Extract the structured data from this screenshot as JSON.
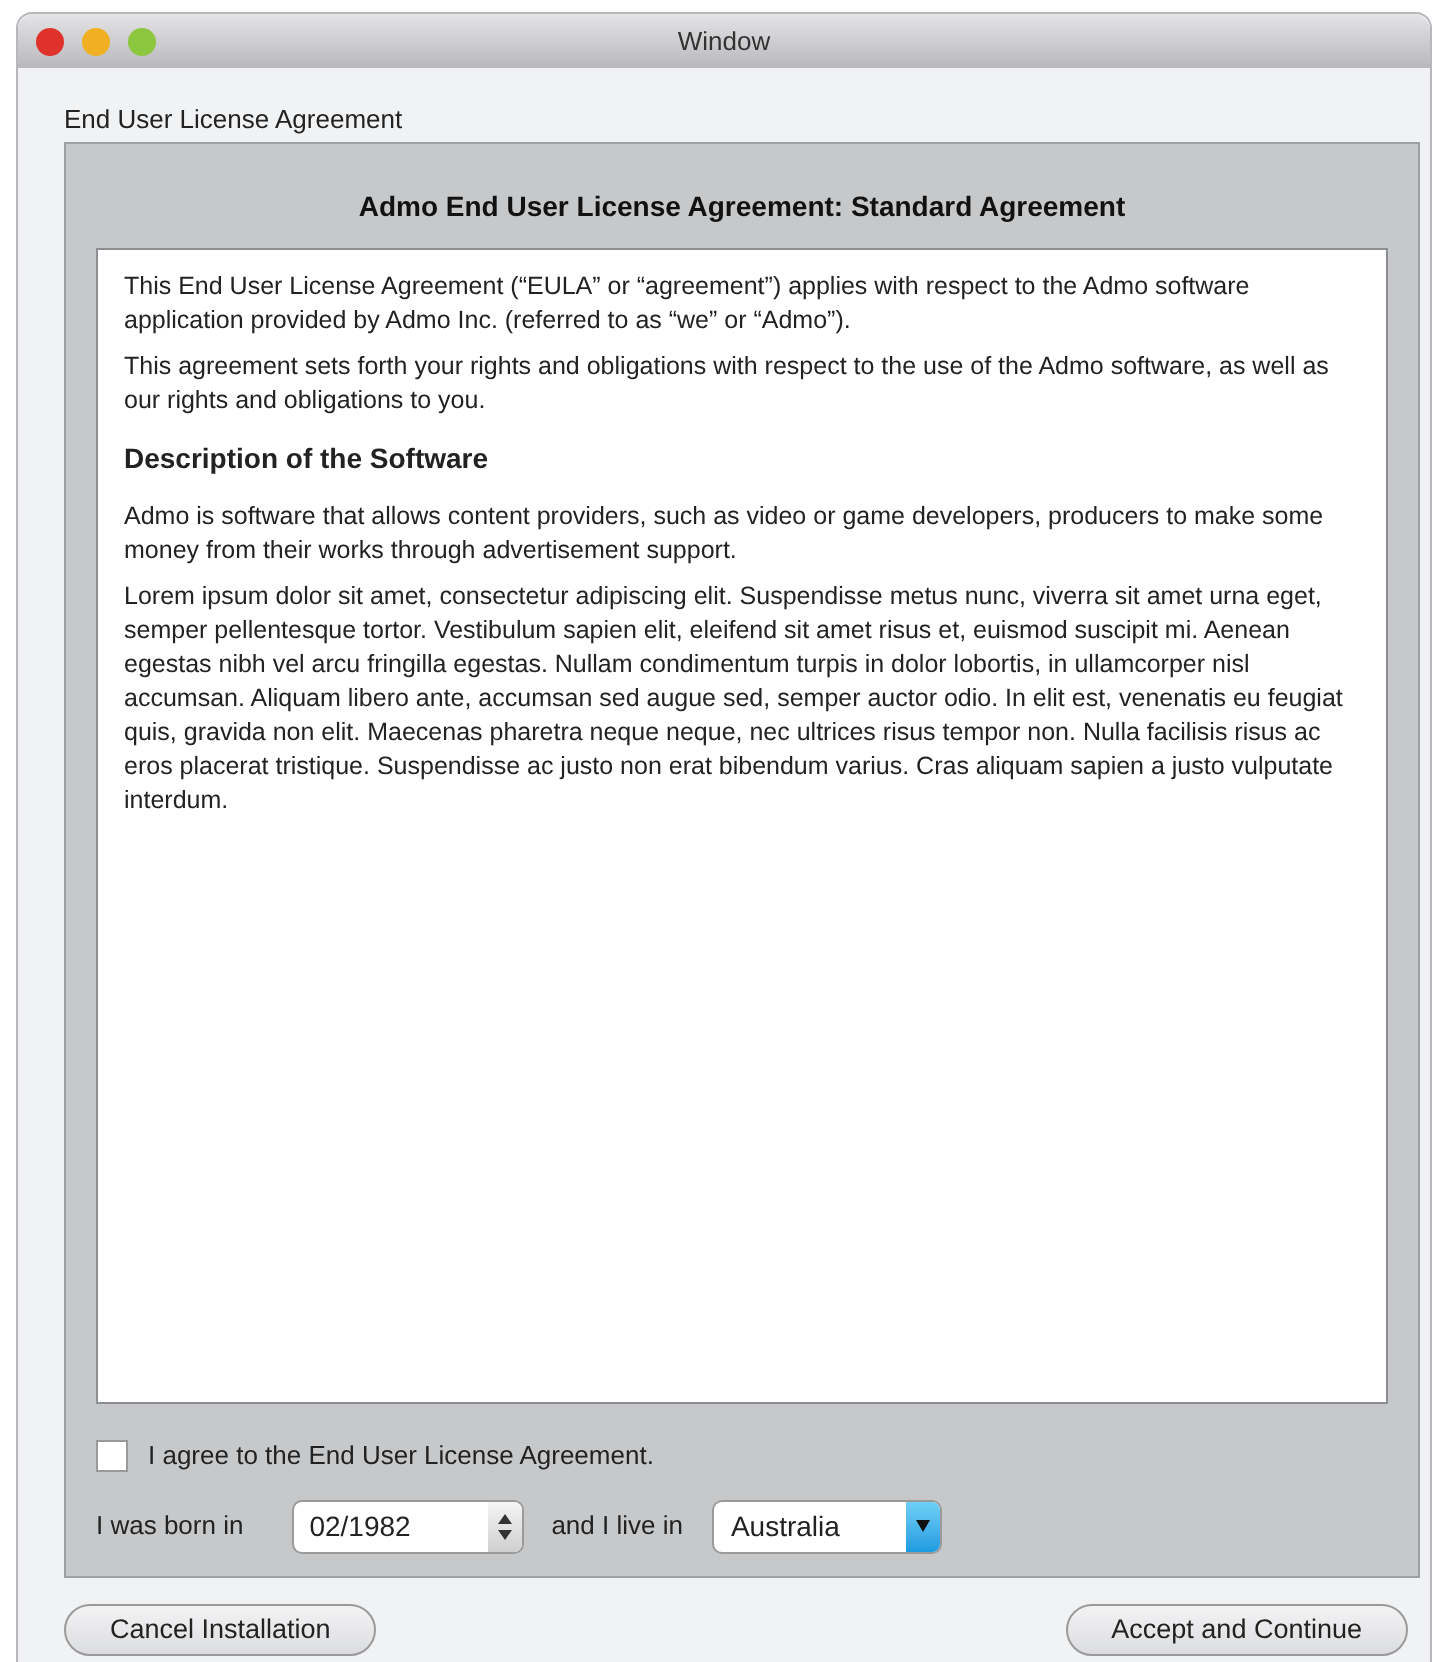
{
  "window": {
    "title": "Window"
  },
  "group_label": "End User License Agreement",
  "agreement": {
    "title": "Admo End User License Agreement: Standard Agreement",
    "blocks": [
      {
        "kind": "paragraph",
        "text": "This End User License Agreement (“EULA” or “agreement”) applies with respect to the Admo software application provided by Admo Inc. (referred to as “we” or “Admo”)."
      },
      {
        "kind": "paragraph",
        "text": "This agreement sets forth your rights and obligations with respect to the use of the Admo software, as well as our rights and obligations to you."
      },
      {
        "kind": "heading",
        "text": "Description of the Software"
      },
      {
        "kind": "paragraph",
        "text": "Admo is software that allows content providers, such as video or game developers, producers to make some money from their works through advertisement support."
      },
      {
        "kind": "paragraph",
        "text": "Lorem ipsum dolor sit amet, consectetur adipiscing elit. Suspendisse metus nunc, viverra sit amet urna eget, semper pellentesque tortor. Vestibulum sapien elit, eleifend sit amet risus et, euismod suscipit mi. Aenean egestas nibh vel arcu fringilla egestas. Nullam condimentum turpis in dolor lobortis, in ullamcorper nisl accumsan. Aliquam libero ante, accumsan sed augue sed, semper auctor odio. In elit est, venenatis eu feugiat quis, gravida non elit. Maecenas pharetra neque neque, nec ultrices risus tempor non. Nulla facilisis risus ac eros placerat tristique. Suspendisse ac justo non erat bibendum varius. Cras aliquam sapien a justo vulputate interdum."
      }
    ]
  },
  "agree": {
    "label": "I agree to the End User License Agreement.",
    "checked": false
  },
  "born_label": "I was born in",
  "birth_date": "02/1982",
  "live_label": "and I live in",
  "country": "Australia",
  "buttons": [
    {
      "label": "Cancel Installation"
    },
    {
      "label": "Accept and Continue"
    }
  ]
}
